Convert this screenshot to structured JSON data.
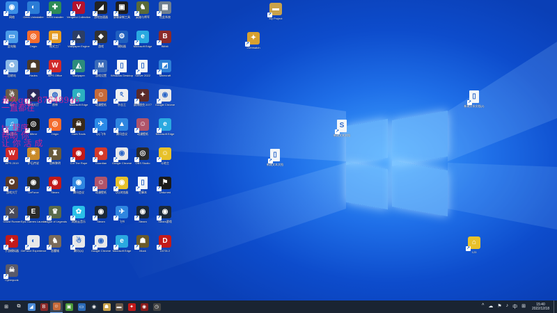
{
  "colors": {
    "desktop": "#0d4ccc",
    "taskbar": "#1a2432",
    "watermark": "#e0208f"
  },
  "watermark": {
    "lines": [
      "永久qq：87648946",
      "一直都在",
      "tx 程序",
      "帮助 你",
      "让 你 活 成"
    ]
  },
  "desktop_icons": [
    {
      "label": "网络",
      "icon": "network-icon",
      "color": "#3a8ee6",
      "glyph": "◉"
    },
    {
      "label": "Geek Uninstaller",
      "icon": "globe-icon",
      "color": "#2b7cd6",
      "glyph": "◐"
    },
    {
      "label": "WEB Installer",
      "icon": "web-installer-icon",
      "color": "#2e8b57",
      "glyph": "✚"
    },
    {
      "label": "Vengeful Collection",
      "icon": "vengeful-icon",
      "color": "#b3122f",
      "glyph": "V"
    },
    {
      "label": "游戏加速器",
      "icon": "game-booster-icon",
      "color": "#222222",
      "glyph": "◢"
    },
    {
      "label": "屏幕录制工具",
      "icon": "recorder-icon",
      "color": "#1d1d1d",
      "glyph": "▣"
    },
    {
      "label": "英雄与将军",
      "icon": "game-icon",
      "color": "#5a6a3a",
      "glyph": "♞"
    },
    {
      "label": "在此系统",
      "icon": "system-icon",
      "color": "#6f7f8f",
      "glyph": "▦"
    },
    {
      "label": "此电脑",
      "icon": "computer-icon",
      "color": "#4a9be8",
      "glyph": "▭"
    },
    {
      "label": "Origin",
      "icon": "origin-icon",
      "color": "#f56c2d",
      "glyph": "◎"
    },
    {
      "label": "格式工厂",
      "icon": "format-icon",
      "color": "#e59b23",
      "glyph": "▤"
    },
    {
      "label": "Wallpaper Engine",
      "icon": "wallpaper-icon",
      "color": "#2c3e66",
      "glyph": "▲"
    },
    {
      "label": "游戏",
      "icon": "game-icon",
      "color": "#333333",
      "glyph": "◆"
    },
    {
      "label": "模拟器",
      "icon": "emulator-icon",
      "color": "#1f5fbf",
      "glyph": "⚙"
    },
    {
      "label": "Microsoft Edge",
      "icon": "edge-icon",
      "color": "#2aa9e0",
      "glyph": "e"
    },
    {
      "label": "Bilibili",
      "icon": "bilibili-icon",
      "color": "#8b2a2a",
      "glyph": "B"
    },
    {
      "label": "回收站",
      "icon": "recycle-bin-icon",
      "color": "#8ab8e6",
      "glyph": "♻"
    },
    {
      "label": "Hades",
      "icon": "hades-icon",
      "color": "#4a3a2a",
      "glyph": "☗"
    },
    {
      "label": "WPS Office",
      "icon": "wps-icon",
      "color": "#d12a2a",
      "glyph": "W"
    },
    {
      "label": "Wallpaper",
      "icon": "wallpaper-icon",
      "color": "#2c8c7c",
      "glyph": "◭"
    },
    {
      "label": "游戏设置",
      "icon": "settings-icon",
      "color": "#3a6ab8",
      "glyph": "M"
    },
    {
      "label": "Windows Desktop",
      "icon": "document-icon",
      "color": "#f4f6f8",
      "glyph": "▯"
    },
    {
      "label": "Server 2022",
      "icon": "document-icon",
      "color": "#f4f6f8",
      "glyph": "▯"
    },
    {
      "label": "Minecraft",
      "icon": "minecraft-icon",
      "color": "#2e7fd6",
      "glyph": "◩"
    },
    {
      "label": "QQ",
      "icon": "game-icon",
      "color": "#6a5a4a",
      "glyph": "☃"
    },
    {
      "label": "游戏大厅",
      "icon": "game-icon",
      "color": "#2a2a5a",
      "glyph": "◈"
    },
    {
      "label": "原神",
      "icon": "genshin-icon",
      "color": "#e6e6e6",
      "glyph": "◍"
    },
    {
      "label": "Microsoft Edge",
      "icon": "edge-icon",
      "color": "#2bb0c0",
      "glyph": "e"
    },
    {
      "label": "动漫壁纸",
      "icon": "anime-icon",
      "color": "#c66a3a",
      "glyph": "☺"
    },
    {
      "label": "杂志王",
      "icon": "game-icon",
      "color": "#f0f0f0",
      "glyph": "ঽ"
    },
    {
      "label": "赛博朋克 2077",
      "icon": "game-icon",
      "color": "#5a2a2a",
      "glyph": "✦"
    },
    {
      "label": "Google Chrome",
      "icon": "chrome-icon",
      "color": "#e8e8e8",
      "glyph": "◉"
    },
    {
      "label": "QQ音乐",
      "icon": "music-icon",
      "color": "#3aa0e8",
      "glyph": "♫"
    },
    {
      "label": "Mirror",
      "icon": "mirror-icon",
      "color": "#1a1a1a",
      "glyph": "◎"
    },
    {
      "label": "Origin",
      "icon": "origin-icon",
      "color": "#f56c2d",
      "glyph": "◎"
    },
    {
      "label": "Dark Souls",
      "icon": "game-icon",
      "color": "#3a2a1a",
      "glyph": "☠"
    },
    {
      "label": "QQ飞车",
      "icon": "qq-icon",
      "color": "#2a8ae8",
      "glyph": "✈"
    },
    {
      "label": "腾讯会议",
      "icon": "meeting-icon",
      "color": "#2f86e0",
      "glyph": "▲"
    },
    {
      "label": "动漫壁纸",
      "icon": "anime-icon",
      "color": "#b0546a",
      "glyph": "☺"
    },
    {
      "label": "Microsoft Edge",
      "icon": "edge-icon",
      "color": "#2aa9e0",
      "glyph": "e"
    },
    {
      "label": "WPS 2019",
      "icon": "wps-icon",
      "color": "#d12a2a",
      "glyph": "W"
    },
    {
      "label": "炉石传说",
      "icon": "hearthstone-icon",
      "color": "#c98a2a",
      "glyph": "✷"
    },
    {
      "label": "恐怖黎明",
      "icon": "game-icon",
      "color": "#6a5a3a",
      "glyph": "♜"
    },
    {
      "label": "Cut The Rope",
      "icon": "game-icon",
      "color": "#c21a1a",
      "glyph": "◉"
    },
    {
      "label": "Guardian",
      "icon": "game-icon",
      "color": "#d43a2a",
      "glyph": "☻"
    },
    {
      "label": "Google Chrome",
      "icon": "chrome-icon",
      "color": "#e8e8e8",
      "glyph": "◉"
    },
    {
      "label": "OBS Studio",
      "icon": "obs-icon",
      "color": "#2a2a2a",
      "glyph": "◎"
    },
    {
      "label": "斗地主",
      "icon": "game-icon",
      "color": "#e8c12a",
      "glyph": "☺"
    },
    {
      "label": "游戏大厅",
      "icon": "game-icon",
      "color": "#5a3a2a",
      "glyph": "✪"
    },
    {
      "label": "GeForce",
      "icon": "geforce-icon",
      "color": "#2a2a2a",
      "glyph": "◉"
    },
    {
      "label": "Steam",
      "icon": "steam-icon",
      "color": "#c21a1a",
      "glyph": "◉"
    },
    {
      "label": "腾讯会议",
      "icon": "meeting-icon",
      "color": "#2f86e0",
      "glyph": "◉"
    },
    {
      "label": "动漫壁纸",
      "icon": "anime-icon",
      "color": "#b0546a",
      "glyph": "☺"
    },
    {
      "label": "QQ浏览器",
      "icon": "qq-browser-icon",
      "color": "#e8c12a",
      "glyph": "◉"
    },
    {
      "label": "记事本",
      "icon": "document-icon",
      "color": "#f4f6f8",
      "glyph": "▯"
    },
    {
      "label": "Unturned",
      "icon": "game-icon",
      "color": "#1a1a1a",
      "glyph": "⚑"
    },
    {
      "label": "Ghost Runner",
      "icon": "game-icon",
      "color": "#4a4a5a",
      "glyph": "⚔"
    },
    {
      "label": "Epic Games Launcher",
      "icon": "epic-icon",
      "color": "#2a2a2a",
      "glyph": "E"
    },
    {
      "label": "League of Legends",
      "icon": "game-icon",
      "color": "#5a6a4a",
      "glyph": "♛"
    },
    {
      "label": "网易云音乐",
      "icon": "music-icon",
      "color": "#2ac0e8",
      "glyph": "✿"
    },
    {
      "label": "Steam",
      "icon": "steam-icon",
      "color": "#1b2838",
      "glyph": "◉"
    },
    {
      "label": "飞书",
      "icon": "feishu-icon",
      "color": "#2f86e0",
      "glyph": "✈"
    },
    {
      "label": "Steam",
      "icon": "steam-icon",
      "color": "#1b2838",
      "glyph": "◉"
    },
    {
      "label": "Steam游戏",
      "icon": "steam-icon",
      "color": "#1b2838",
      "glyph": "◉"
    },
    {
      "label": "手游模拟器",
      "icon": "game-icon",
      "color": "#c21a1a",
      "glyph": "✦"
    },
    {
      "label": "GeForce Experience",
      "icon": "geforce-icon",
      "color": "#e8e8e8",
      "glyph": "◐"
    },
    {
      "label": "恶魔城",
      "icon": "game-icon",
      "color": "#7a6a5a",
      "glyph": "♞"
    },
    {
      "label": "腾讯QQ",
      "icon": "qq-icon",
      "color": "#e8e8e8",
      "glyph": "☃"
    },
    {
      "label": "Google Chrome",
      "icon": "chrome-icon",
      "color": "#e8e8e8",
      "glyph": "◉"
    },
    {
      "label": "Microsoft Edge",
      "icon": "edge-icon",
      "color": "#2aa9e0",
      "glyph": "e"
    },
    {
      "label": "Muck",
      "icon": "game-icon",
      "color": "#6a5a2a",
      "glyph": "☗"
    },
    {
      "label": "DOTA 2",
      "icon": "dota-icon",
      "color": "#c21a1a",
      "glyph": "D"
    },
    {
      "label": "Cyberpunk",
      "icon": "game-icon",
      "color": "#5a5a6a",
      "glyph": "☠"
    }
  ],
  "right_icons": [
    {
      "label": "My Project",
      "icon": "folder-icon",
      "color": "#c9a24a",
      "glyph": "▬"
    },
    {
      "label": "Overwatch",
      "icon": "game-icon",
      "color": "#d6a030",
      "glyph": "✦"
    },
    {
      "label": "新建文本文档(2)",
      "icon": "document-icon",
      "color": "#f4f6f8",
      "glyph": "▯"
    },
    {
      "label": "新建文本文档",
      "icon": "document-icon",
      "color": "#f4f6f8",
      "glyph": "S"
    },
    {
      "label": "新建文本文档",
      "icon": "document-icon",
      "color": "#f4f6f8",
      "glyph": "▯"
    },
    {
      "label": "123",
      "icon": "home-folder-icon",
      "color": "#e8c12a",
      "glyph": "⌂"
    }
  ],
  "taskbar": {
    "apps": [
      {
        "name": "start-icon",
        "glyph": "⊞",
        "color": "#ffffff"
      },
      {
        "name": "task-view-icon",
        "glyph": "⧉",
        "color": "#ffffff"
      },
      {
        "name": "steam-icon",
        "glyph": "◢",
        "color": "#4a8ad8"
      },
      {
        "name": "bilibili-icon",
        "glyph": "B",
        "color": "#8b2a2a"
      },
      {
        "name": "anime-icon",
        "glyph": "☺",
        "color": "#c66a3a"
      },
      {
        "name": "minecraft-icon",
        "glyph": "▣",
        "color": "#4a9a3a"
      },
      {
        "name": "monitor-icon",
        "glyph": "▭",
        "color": "#2a6ab8"
      },
      {
        "name": "steam-icon",
        "glyph": "◉",
        "color": "#1b2838"
      },
      {
        "name": "game-icon",
        "glyph": "☗",
        "color": "#c9a24a"
      },
      {
        "name": "gun-icon",
        "glyph": "▬",
        "color": "#6a5a4a"
      },
      {
        "name": "game-icon",
        "glyph": "✦",
        "color": "#c21a1a"
      },
      {
        "name": "game-icon",
        "glyph": "◉",
        "color": "#8a1a1a"
      },
      {
        "name": "clock-icon",
        "glyph": "◷",
        "color": "#444444"
      }
    ],
    "tray": {
      "icons": [
        "^",
        "☁",
        "⚑",
        "♪",
        "中",
        "⊞"
      ],
      "time": "15:40",
      "date": "2022/12/18"
    }
  }
}
